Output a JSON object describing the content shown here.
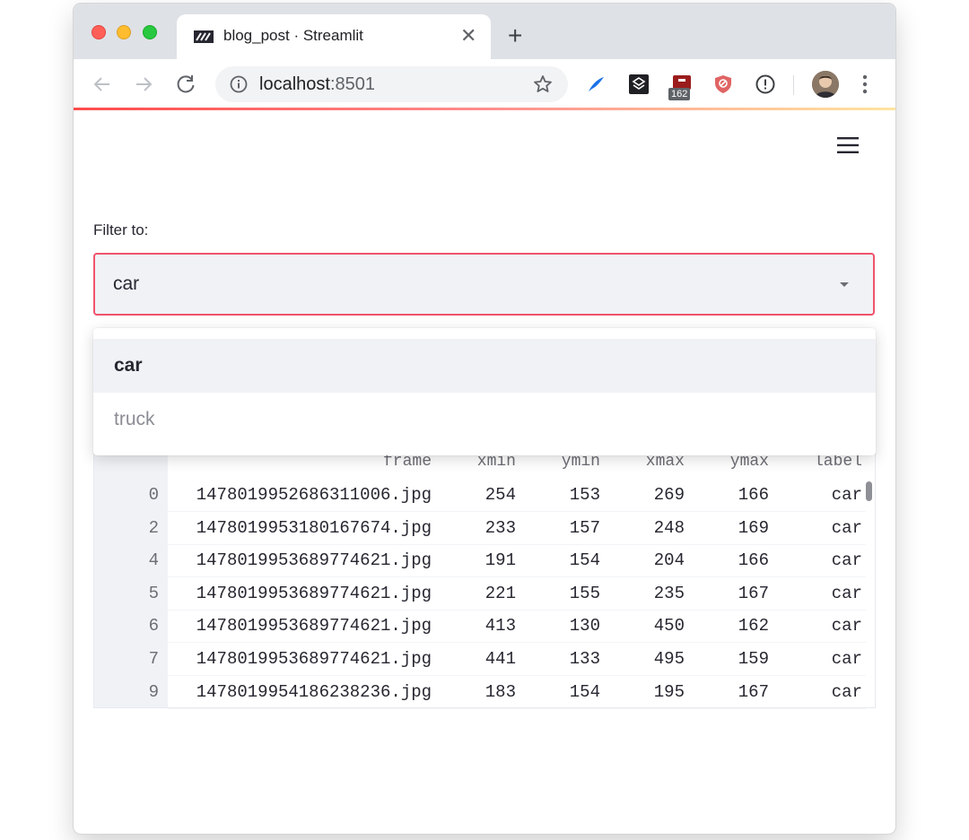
{
  "browser": {
    "tab": {
      "title": "blog_post · Streamlit",
      "close_glyph": "✕"
    },
    "new_tab_glyph": "+",
    "address": {
      "host": "localhost",
      "port": ":8501"
    },
    "extension_badge": "162",
    "icons": [
      "back-arrow-icon",
      "forward-arrow-icon",
      "reload-icon",
      "info-icon",
      "star-icon",
      "kebab-menu-icon"
    ]
  },
  "app": {
    "filter_label": "Filter to:",
    "selectbox": {
      "value": "car",
      "accent": "#f0536c"
    },
    "dropdown": {
      "options": [
        {
          "label": "car",
          "selected": true
        },
        {
          "label": "truck",
          "selected": false
        }
      ]
    },
    "dataframe": {
      "columns": [
        "frame",
        "xmin",
        "ymin",
        "xmax",
        "ymax",
        "label"
      ],
      "rows": [
        {
          "index": "0",
          "frame": "1478019952686311006.jpg",
          "xmin": "254",
          "ymin": "153",
          "xmax": "269",
          "ymax": "166",
          "label": "car"
        },
        {
          "index": "2",
          "frame": "1478019953180167674.jpg",
          "xmin": "233",
          "ymin": "157",
          "xmax": "248",
          "ymax": "169",
          "label": "car"
        },
        {
          "index": "4",
          "frame": "1478019953689774621.jpg",
          "xmin": "191",
          "ymin": "154",
          "xmax": "204",
          "ymax": "166",
          "label": "car"
        },
        {
          "index": "5",
          "frame": "1478019953689774621.jpg",
          "xmin": "221",
          "ymin": "155",
          "xmax": "235",
          "ymax": "167",
          "label": "car"
        },
        {
          "index": "6",
          "frame": "1478019953689774621.jpg",
          "xmin": "413",
          "ymin": "130",
          "xmax": "450",
          "ymax": "162",
          "label": "car"
        },
        {
          "index": "7",
          "frame": "1478019953689774621.jpg",
          "xmin": "441",
          "ymin": "133",
          "xmax": "495",
          "ymax": "159",
          "label": "car"
        },
        {
          "index": "9",
          "frame": "1478019954186238236.jpg",
          "xmin": "183",
          "ymin": "154",
          "xmax": "195",
          "ymax": "167",
          "label": "car"
        }
      ]
    }
  }
}
